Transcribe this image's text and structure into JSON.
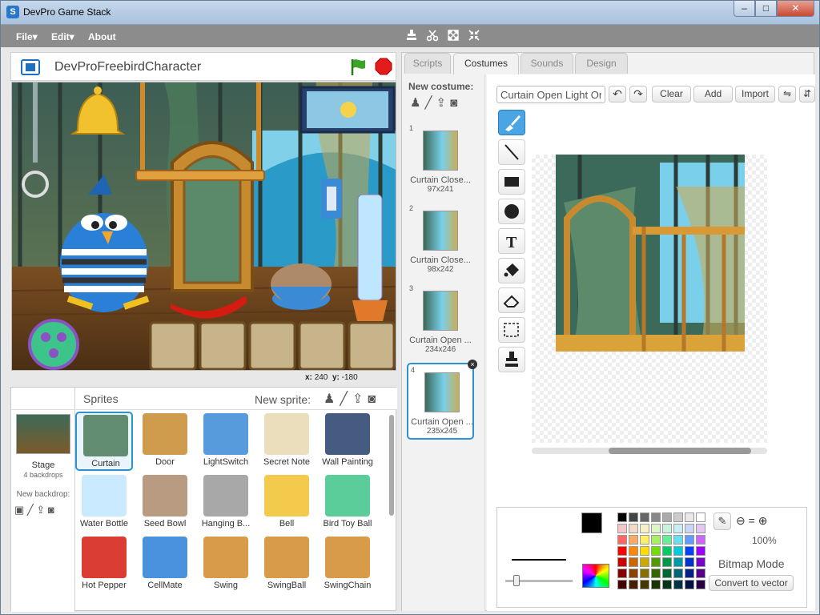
{
  "window": {
    "title": "DevPro Game Stack",
    "buttons": {
      "minimize": "–",
      "maximize": "□",
      "close": "✕"
    }
  },
  "menu": {
    "file": "File▾",
    "edit": "Edit▾",
    "about": "About"
  },
  "toolbar_icons": [
    "stamp-icon",
    "cut-icon",
    "grow-icon",
    "shrink-icon"
  ],
  "stage": {
    "project_name": "DevProFreebirdCharacter",
    "coords": {
      "x_label": "x:",
      "x": "240",
      "y_label": "y:",
      "y": "-180"
    }
  },
  "sprites_panel": {
    "title": "Sprites",
    "new_sprite_label": "New sprite:",
    "stage_label": "Stage",
    "backdrops": "4 backdrops",
    "new_backdrop_label": "New backdrop:",
    "sprites": [
      {
        "label": "Curtain",
        "selected": true
      },
      {
        "label": "Door"
      },
      {
        "label": "LightSwitch"
      },
      {
        "label": "Secret Note"
      },
      {
        "label": "Wall Painting"
      },
      {
        "label": "Water Bottle"
      },
      {
        "label": "Seed Bowl"
      },
      {
        "label": "Hanging B..."
      },
      {
        "label": "Bell"
      },
      {
        "label": "Bird Toy Ball"
      },
      {
        "label": "Hot Pepper"
      },
      {
        "label": "CellMate"
      },
      {
        "label": "Swing"
      },
      {
        "label": "SwingBall"
      },
      {
        "label": "SwingChain"
      }
    ]
  },
  "editor": {
    "tabs": [
      {
        "label": "Scripts"
      },
      {
        "label": "Costumes",
        "active": true
      },
      {
        "label": "Sounds"
      },
      {
        "label": "Design"
      }
    ],
    "new_costume_label": "New costume:",
    "costumes": [
      {
        "num": "1",
        "name": "Curtain Close...",
        "size": "97x241"
      },
      {
        "num": "2",
        "name": "Curtain Close...",
        "size": "98x242"
      },
      {
        "num": "3",
        "name": "Curtain Open ...",
        "size": "234x246"
      },
      {
        "num": "4",
        "name": "Curtain Open ...",
        "size": "235x245",
        "selected": true
      }
    ],
    "costume_name_value": "Curtain Open Light On",
    "buttons": {
      "clear": "Clear",
      "add": "Add",
      "import": "Import"
    },
    "tools": [
      "brush-tool",
      "line-tool",
      "rectangle-tool",
      "ellipse-tool",
      "text-tool",
      "fill-tool",
      "eraser-tool",
      "select-tool",
      "stamp-tool"
    ],
    "zoom": "100%",
    "mode_label": "Bitmap Mode",
    "convert_button": "Convert to vector",
    "palette": [
      "#000000",
      "#444444",
      "#666666",
      "#888888",
      "#aaaaaa",
      "#cccccc",
      "#e8e8e8",
      "#ffffff",
      "#f4c7c7",
      "#f4d9c7",
      "#f4f0c7",
      "#dff4c7",
      "#c7f4da",
      "#c7eef4",
      "#c7d7f4",
      "#e4c7f4",
      "#ff6666",
      "#ffaa66",
      "#ffee66",
      "#aaee66",
      "#66ee99",
      "#66e0ee",
      "#6699ff",
      "#cc66ff",
      "#ff0000",
      "#ff8800",
      "#ffdd00",
      "#77dd00",
      "#00cc66",
      "#00ccdd",
      "#0044ff",
      "#9900ff",
      "#cc0000",
      "#cc6600",
      "#cca800",
      "#559900",
      "#00994c",
      "#0099aa",
      "#0033cc",
      "#7700cc",
      "#880000",
      "#884400",
      "#887000",
      "#336600",
      "#006633",
      "#006677",
      "#002288",
      "#550088",
      "#440000",
      "#442200",
      "#443800",
      "#1a3300",
      "#00331a",
      "#003344",
      "#001144",
      "#2a0044"
    ],
    "primary_color": "#000000",
    "secondary_color": "#ffffff"
  }
}
